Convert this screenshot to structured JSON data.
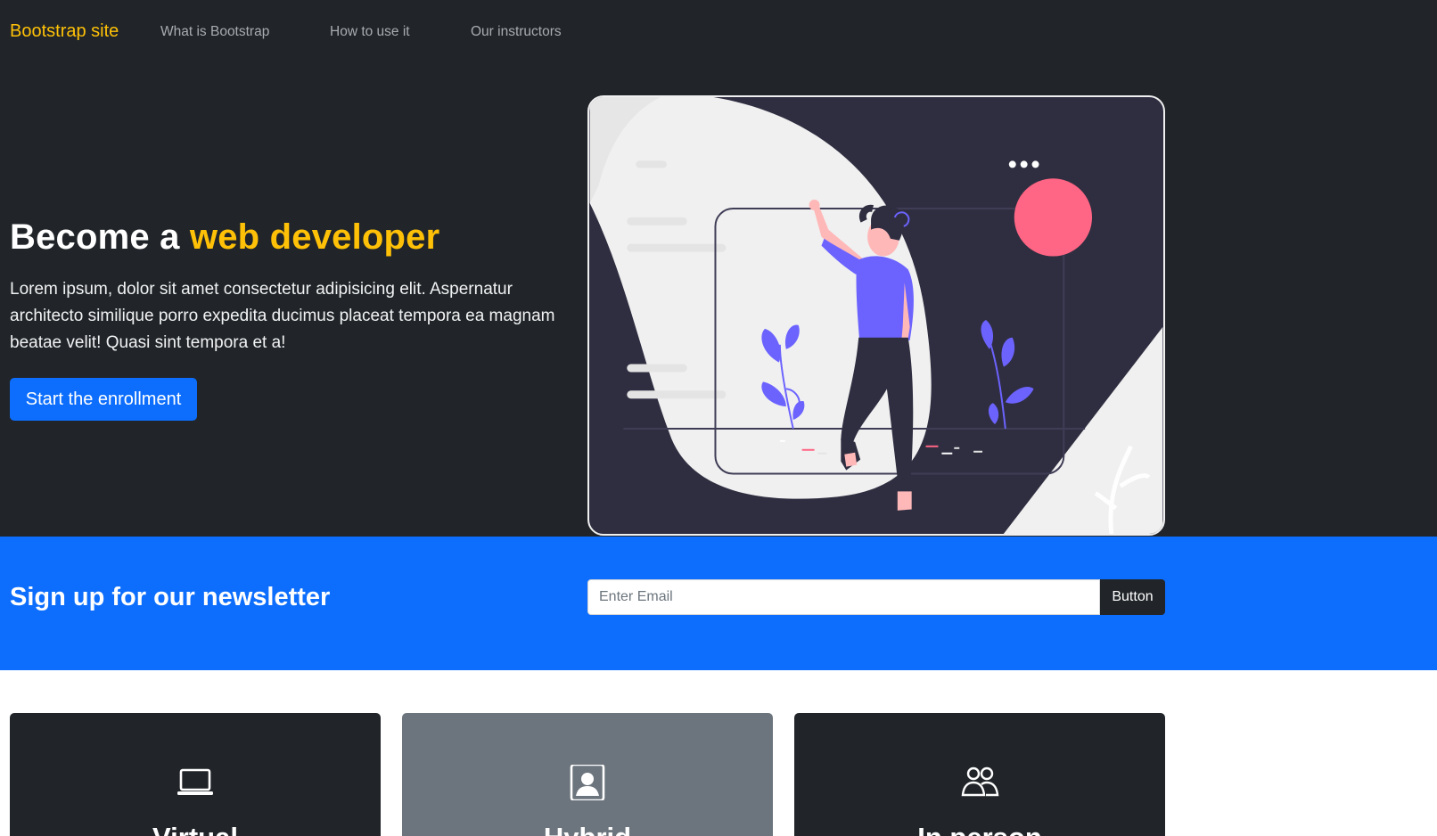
{
  "navbar": {
    "brand": "Bootstrap site",
    "links": [
      {
        "label": "What is Bootstrap"
      },
      {
        "label": "How to use it"
      },
      {
        "label": "Our instructors"
      }
    ]
  },
  "hero": {
    "title_prefix": "Become a ",
    "title_highlight": "web developer",
    "lead": "Lorem ipsum, dolor sit amet consectetur adipisicing elit. Aspernatur architecto similique porro expedita ducimus placeat tempora ea magnam beatae velit! Quasi sint tempora et a!",
    "button_label": "Start the enrollment",
    "illustration_icon": "woman-browsing-illustration"
  },
  "newsletter": {
    "title": "Sign up for our newsletter",
    "input_placeholder": "Enter Email",
    "button_label": "Button"
  },
  "cards": [
    {
      "title": "Virtual",
      "icon": "laptop-icon",
      "theme": "dark"
    },
    {
      "title": "Hybrid",
      "icon": "person-badge-icon",
      "theme": "gray"
    },
    {
      "title": "In person",
      "icon": "people-icon",
      "theme": "dark"
    }
  ],
  "colors": {
    "dark": "#212529",
    "accent": "#ffc107",
    "primary": "#0d6efd",
    "secondary": "#6c757d",
    "illustration_purple": "#6c63ff",
    "illustration_pink": "#ff6584"
  }
}
